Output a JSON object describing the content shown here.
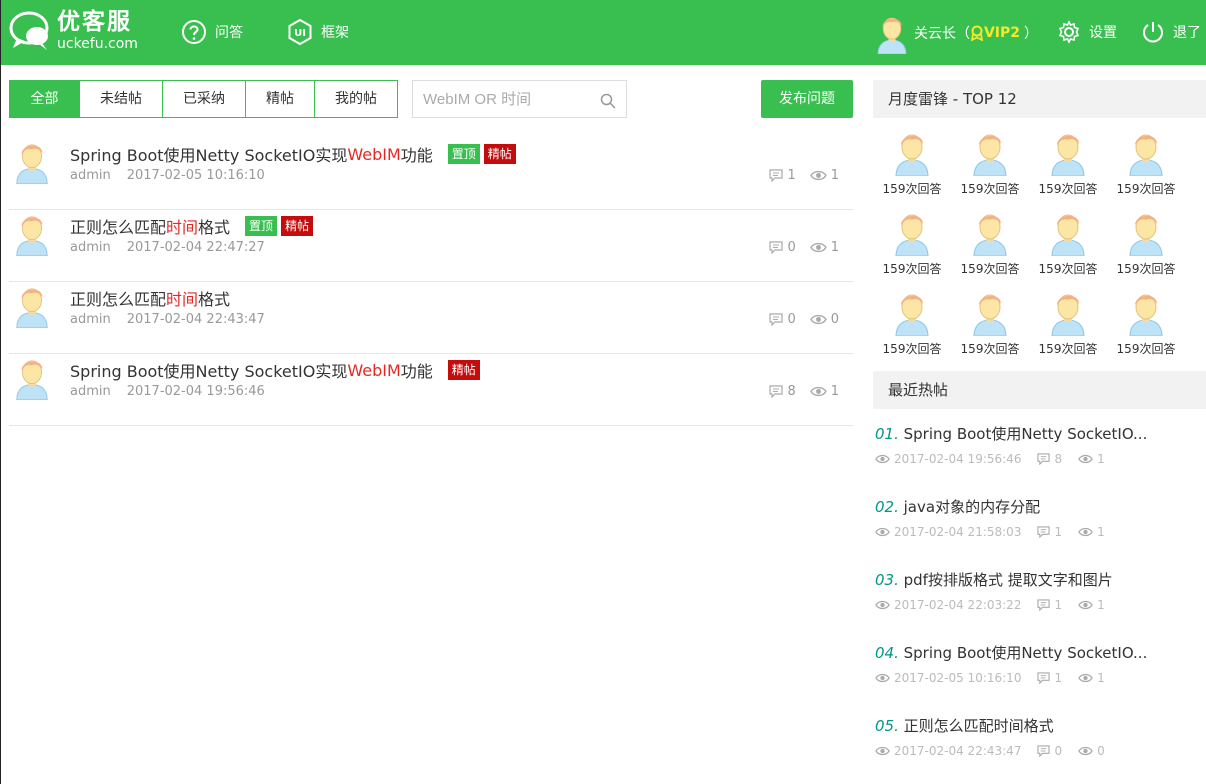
{
  "header": {
    "logo_title": "优客服",
    "logo_sub": "uckefu.com",
    "nav": [
      {
        "label": "问答"
      },
      {
        "label": "框架"
      }
    ],
    "user_name": "关云长（",
    "vip": "VIP2",
    "vip_close": "）",
    "settings": "设置",
    "logout": "退了"
  },
  "tabs": [
    {
      "label": "全部"
    },
    {
      "label": "未结帖"
    },
    {
      "label": "已采纳"
    },
    {
      "label": "精帖"
    },
    {
      "label": "我的帖"
    }
  ],
  "search": {
    "placeholder": "WebIM OR 时间"
  },
  "publish": "发布问题",
  "posts": [
    {
      "title_a": "Spring Boot使用Netty SocketIO实现",
      "title_hl": "WebIM",
      "title_b": "功能",
      "badge_top": "置顶",
      "badge_fine": "精帖",
      "author": "admin",
      "time": "2017-02-05 10:16:10",
      "comments": "1",
      "views": "1"
    },
    {
      "title_a": "正则怎么匹配",
      "title_hl": "时间",
      "title_b": "格式",
      "badge_top": "置顶",
      "badge_fine": "精帖",
      "author": "admin",
      "time": "2017-02-04 22:47:27",
      "comments": "0",
      "views": "1"
    },
    {
      "title_a": "正则怎么匹配",
      "title_hl": "时间",
      "title_b": "格式",
      "author": "admin",
      "time": "2017-02-04 22:43:47",
      "comments": "0",
      "views": "0"
    },
    {
      "title_a": "Spring Boot使用Netty SocketIO实现",
      "title_hl": "WebIM",
      "title_b": "功能",
      "badge_fine": "精帖",
      "author": "admin",
      "time": "2017-02-04 19:56:46",
      "comments": "8",
      "views": "1"
    }
  ],
  "sidebar": {
    "top_title": "月度雷锋 - TOP 12",
    "top_users": [
      "159次回答",
      "159次回答",
      "159次回答",
      "159次回答",
      "159次回答",
      "159次回答",
      "159次回答",
      "159次回答",
      "159次回答",
      "159次回答",
      "159次回答",
      "159次回答"
    ],
    "hot_title": "最近热帖",
    "hot": [
      {
        "num": "01.",
        "title": "Spring Boot使用Netty SocketIO...",
        "time": "2017-02-04 19:56:46",
        "comments": "8",
        "views": "1"
      },
      {
        "num": "02.",
        "title": "java对象的内存分配",
        "time": "2017-02-04 21:58:03",
        "comments": "1",
        "views": "1"
      },
      {
        "num": "03.",
        "title": "pdf按排版格式 提取文字和图片",
        "time": "2017-02-04 22:03:22",
        "comments": "1",
        "views": "1"
      },
      {
        "num": "04.",
        "title": "Spring Boot使用Netty SocketIO...",
        "time": "2017-02-05 10:16:10",
        "comments": "1",
        "views": "1"
      },
      {
        "num": "05.",
        "title": "正则怎么匹配时间格式",
        "time": "2017-02-04 22:43:47",
        "comments": "0",
        "views": "0"
      }
    ]
  },
  "colors": {
    "brand": "#39bf4f",
    "highlight": "#e42a23",
    "fine_badge": "#c50c0c",
    "hot_num": "#009688",
    "vip": "#f5e72a"
  }
}
